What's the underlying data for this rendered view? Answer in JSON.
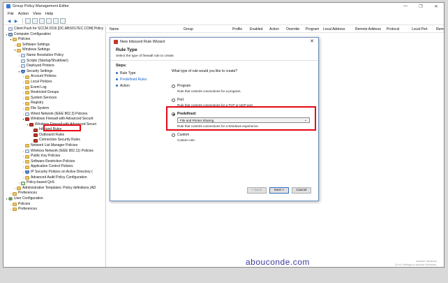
{
  "window": {
    "title": "Group Policy Management Editor",
    "controls": [
      "—",
      "❐",
      "✕"
    ]
  },
  "menu": [
    "File",
    "Action",
    "View",
    "Help"
  ],
  "tree": [
    {
      "label": "Client Push for SCCM 2016 [DC.ABSOLTEC.COM] Policy",
      "indent": 0,
      "exp": "",
      "icon": "doc"
    },
    {
      "label": "Computer Configuration",
      "indent": 0,
      "exp": "v",
      "icon": "comp"
    },
    {
      "label": "Policies",
      "indent": 1,
      "exp": "v",
      "icon": "folder"
    },
    {
      "label": "Software Settings",
      "indent": 2,
      "exp": ">",
      "icon": "folder"
    },
    {
      "label": "Windows Settings",
      "indent": 2,
      "exp": "v",
      "icon": "folder"
    },
    {
      "label": "Name Resolution Policy",
      "indent": 3,
      "exp": ">",
      "icon": "doc"
    },
    {
      "label": "Scripts (Startup/Shutdown)",
      "indent": 3,
      "exp": "",
      "icon": "doc"
    },
    {
      "label": "Deployed Printers",
      "indent": 3,
      "exp": ">",
      "icon": "doc"
    },
    {
      "label": "Security Settings",
      "indent": 3,
      "exp": "v",
      "icon": "shield"
    },
    {
      "label": "Account Policies",
      "indent": 4,
      "exp": ">",
      "icon": "folder"
    },
    {
      "label": "Local Policies",
      "indent": 4,
      "exp": ">",
      "icon": "folder"
    },
    {
      "label": "Event Log",
      "indent": 4,
      "exp": ">",
      "icon": "folder"
    },
    {
      "label": "Restricted Groups",
      "indent": 4,
      "exp": ">",
      "icon": "folder"
    },
    {
      "label": "System Services",
      "indent": 4,
      "exp": ">",
      "icon": "folder"
    },
    {
      "label": "Registry",
      "indent": 4,
      "exp": ">",
      "icon": "folder"
    },
    {
      "label": "File System",
      "indent": 4,
      "exp": ">",
      "icon": "folder"
    },
    {
      "label": "Wired Network (IEEE 802.3) Policies",
      "indent": 4,
      "exp": ">",
      "icon": "doc"
    },
    {
      "label": "Windows Firewall with Advanced Securit",
      "indent": 4,
      "exp": "v",
      "icon": "fw"
    },
    {
      "label": "Windows Firewall with Advanced Securi",
      "indent": 5,
      "exp": "v",
      "icon": "fw"
    },
    {
      "label": "Inbound Rules",
      "indent": 6,
      "exp": "",
      "icon": "fw"
    },
    {
      "label": "Outbound Rules",
      "indent": 6,
      "exp": "",
      "icon": "fw"
    },
    {
      "label": "Connection Security Rules",
      "indent": 6,
      "exp": "",
      "icon": "fw"
    },
    {
      "label": "Network List Manager Policies",
      "indent": 4,
      "exp": "",
      "icon": "folder"
    },
    {
      "label": "Wireless Network (IEEE 802.11) Policies",
      "indent": 4,
      "exp": ">",
      "icon": "doc"
    },
    {
      "label": "Public Key Policies",
      "indent": 4,
      "exp": ">",
      "icon": "folder"
    },
    {
      "label": "Software Restriction Policies",
      "indent": 4,
      "exp": ">",
      "icon": "folder"
    },
    {
      "label": "Application Control Policies",
      "indent": 4,
      "exp": ">",
      "icon": "folder"
    },
    {
      "label": "IP Security Policies on Active Directory (",
      "indent": 4,
      "exp": ">",
      "icon": "shield"
    },
    {
      "label": "Advanced Audit Policy Configuration",
      "indent": 4,
      "exp": ">",
      "icon": "folder"
    },
    {
      "label": "Policy-based QoS",
      "indent": 3,
      "exp": ">",
      "icon": "chart"
    },
    {
      "label": "Administrative Templates: Policy definitions (AD",
      "indent": 2,
      "exp": ">",
      "icon": "folder"
    },
    {
      "label": "Preferences",
      "indent": 1,
      "exp": ">",
      "icon": "folder"
    },
    {
      "label": "User Configuration",
      "indent": 0,
      "exp": "v",
      "icon": "user"
    },
    {
      "label": "Policies",
      "indent": 1,
      "exp": ">",
      "icon": "folder"
    },
    {
      "label": "Preferences",
      "indent": 1,
      "exp": ">",
      "icon": "folder"
    }
  ],
  "columns": [
    "Name",
    "Group",
    "Profile",
    "Enabled",
    "Action",
    "Override",
    "Program",
    "Local Address",
    "Remote Address",
    "Protocol",
    "Local Port",
    "Remo"
  ],
  "dialog": {
    "title": "New Inbound Rule Wizard",
    "heading": "Rule Type",
    "subheading": "Select the type of firewall rule to create.",
    "steps_header": "Steps:",
    "steps": [
      "Rule Type",
      "Predefined Rules",
      "Action"
    ],
    "question": "What type of rule would you like to create?",
    "options": [
      {
        "label": "Program",
        "desc": "Rule that controls connections for a program.",
        "checked": false
      },
      {
        "label": "Port",
        "desc": "Rule that controls connections for a TCP or UDP port.",
        "checked": false
      },
      {
        "label": "Predefined:",
        "desc": "Rule that controls connections for a Windows experience.",
        "checked": true,
        "select_value": "File and Printer Sharing"
      },
      {
        "label": "Custom",
        "desc": "Custom rule.",
        "checked": false
      }
    ],
    "buttons": {
      "back": "< Back",
      "next": "Next >",
      "cancel": "Cancel"
    }
  },
  "watermark": "abouconde.com",
  "activate": [
    "Activate Windows",
    "Go to Settings to activate Windows."
  ]
}
